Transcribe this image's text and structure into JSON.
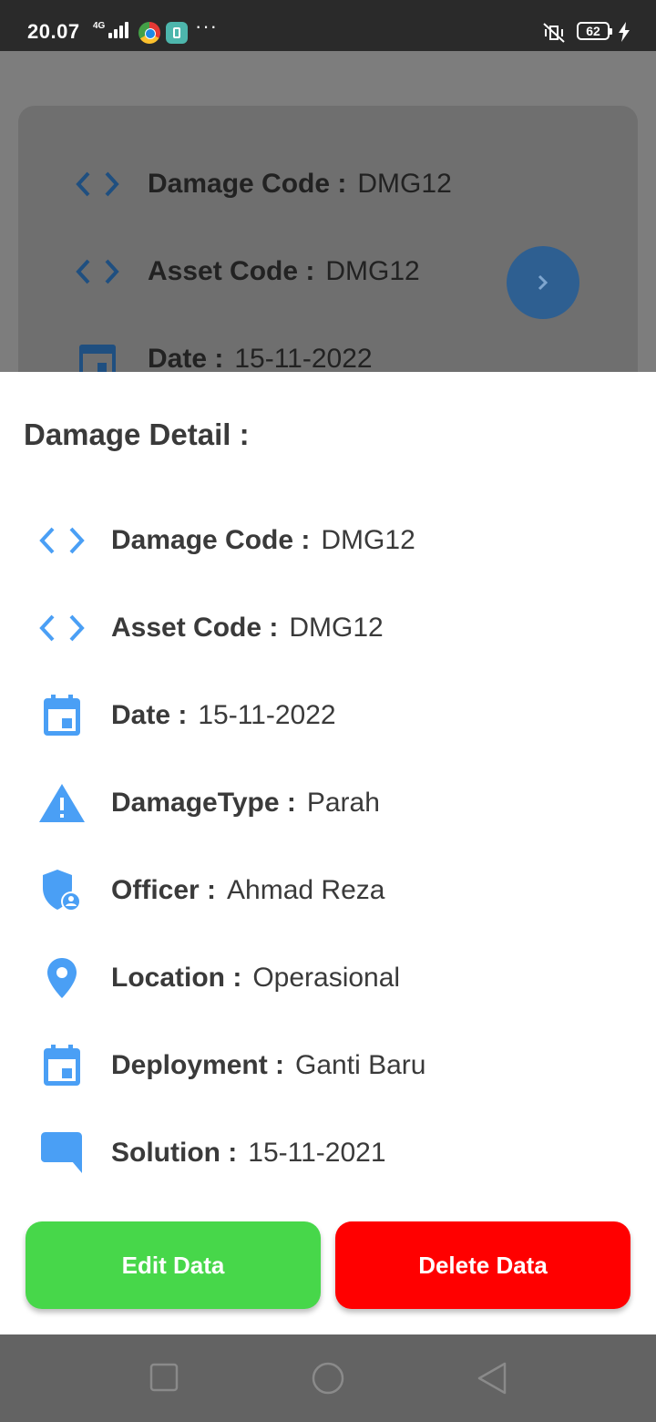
{
  "status_bar": {
    "time": "20.07",
    "network": "4G",
    "battery": "62"
  },
  "background_card": {
    "rows": [
      {
        "key": "Damage Code :",
        "value": "DMG12",
        "icon": "code-icon"
      },
      {
        "key": "Asset Code :",
        "value": "DMG12",
        "icon": "code-icon"
      },
      {
        "key": "Date :",
        "value": "15-11-2022",
        "icon": "calendar-icon"
      }
    ]
  },
  "sheet": {
    "title": "Damage Detail :",
    "rows": [
      {
        "key": "Damage Code :",
        "value": "DMG12",
        "icon": "code-icon"
      },
      {
        "key": "Asset Code :",
        "value": "DMG12",
        "icon": "code-icon"
      },
      {
        "key": "Date :",
        "value": "15-11-2022",
        "icon": "calendar-icon"
      },
      {
        "key": "DamageType :",
        "value": "Parah",
        "icon": "warning-icon"
      },
      {
        "key": "Officer :",
        "value": "Ahmad Reza",
        "icon": "shield-user-icon"
      },
      {
        "key": "Location :",
        "value": "Operasional",
        "icon": "location-pin-icon"
      },
      {
        "key": "Deployment :",
        "value": "Ganti Baru",
        "icon": "calendar-icon"
      },
      {
        "key": "Solution :",
        "value": "15-11-2021",
        "icon": "comment-icon"
      }
    ],
    "edit_label": "Edit Data",
    "delete_label": "Delete Data"
  },
  "colors": {
    "icon_blue": "#4a9ff5",
    "edit_green": "#47d74a",
    "delete_red": "#ff0000"
  }
}
